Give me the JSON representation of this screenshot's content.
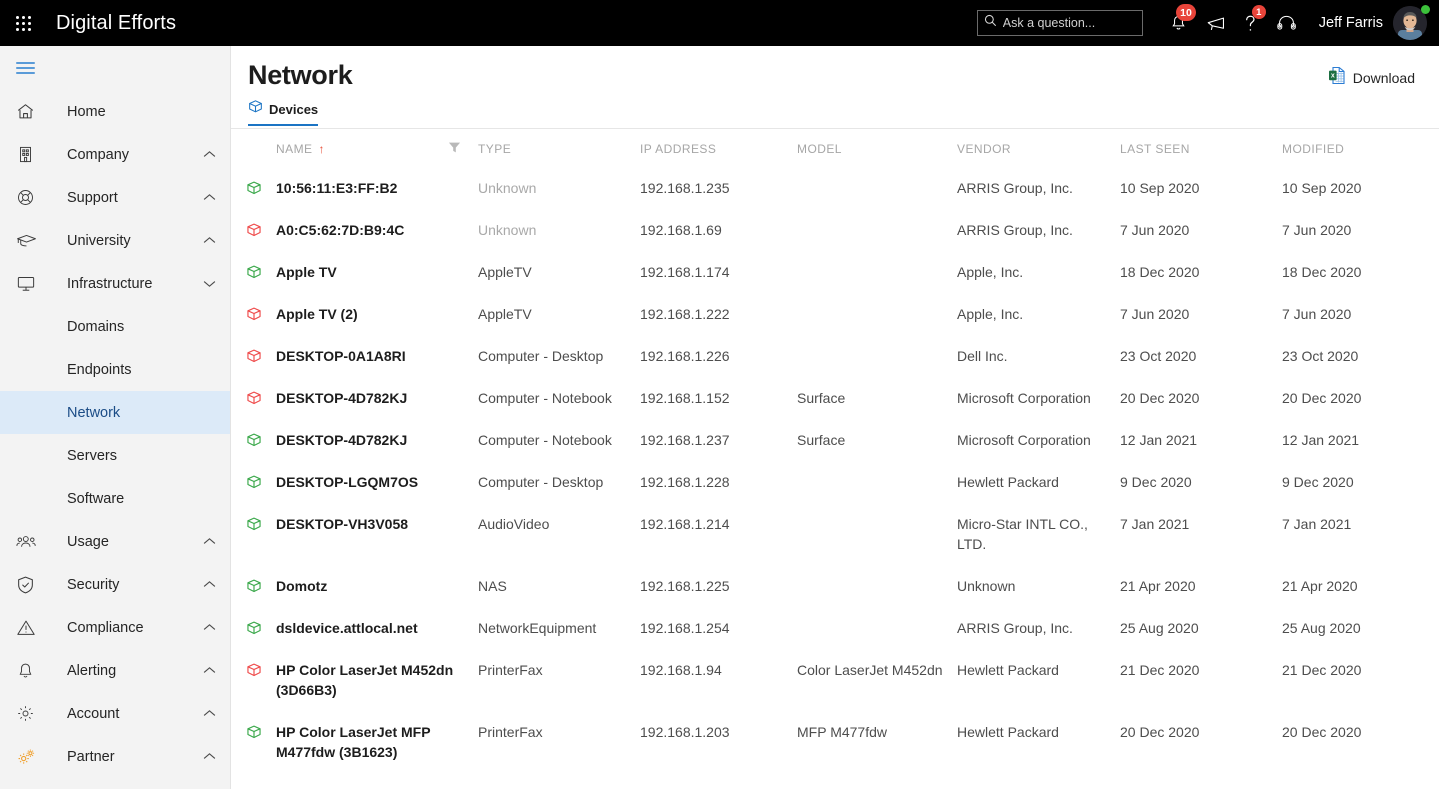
{
  "topbar": {
    "waffle_icon": "app-launcher-icon",
    "brand": "Digital Efforts",
    "search": {
      "placeholder": "Ask a question...",
      "value": "",
      "icon": "search-icon"
    },
    "notifications": {
      "icon": "bell-icon",
      "badge": "10"
    },
    "announcements": {
      "icon": "megaphone-icon"
    },
    "help": {
      "icon": "question-mark-icon",
      "badge": "1"
    },
    "support": {
      "icon": "headset-icon"
    },
    "user": {
      "name": "Jeff Farris",
      "status": "online",
      "status_color": "#3cc13b"
    }
  },
  "sidebar": {
    "menu_icon": "hamburger-icon",
    "accent": "#5a9bd8",
    "active_bg": "#dceaf8",
    "items": [
      {
        "label": "Home",
        "icon": "home-icon",
        "chevron": "",
        "child": false,
        "active": false
      },
      {
        "label": "Company",
        "icon": "building-icon",
        "chevron": "up",
        "child": false,
        "active": false
      },
      {
        "label": "Support",
        "icon": "lifebuoy-icon",
        "chevron": "up",
        "child": false,
        "active": false
      },
      {
        "label": "University",
        "icon": "graduation-cap-icon",
        "chevron": "up",
        "child": false,
        "active": false
      },
      {
        "label": "Infrastructure",
        "icon": "monitor-icon",
        "chevron": "down",
        "child": false,
        "active": false
      },
      {
        "label": "Domains",
        "icon": "",
        "chevron": "",
        "child": true,
        "active": false
      },
      {
        "label": "Endpoints",
        "icon": "",
        "chevron": "",
        "child": true,
        "active": false
      },
      {
        "label": "Network",
        "icon": "",
        "chevron": "",
        "child": true,
        "active": true
      },
      {
        "label": "Servers",
        "icon": "",
        "chevron": "",
        "child": true,
        "active": false
      },
      {
        "label": "Software",
        "icon": "",
        "chevron": "",
        "child": true,
        "active": false
      },
      {
        "label": "Usage",
        "icon": "people-icon",
        "chevron": "up",
        "child": false,
        "active": false
      },
      {
        "label": "Security",
        "icon": "shield-check-icon",
        "chevron": "up",
        "child": false,
        "active": false
      },
      {
        "label": "Compliance",
        "icon": "warning-triangle-icon",
        "chevron": "up",
        "child": false,
        "active": false
      },
      {
        "label": "Alerting",
        "icon": "bell-icon",
        "chevron": "up",
        "child": false,
        "active": false
      },
      {
        "label": "Account",
        "icon": "gear-icon",
        "chevron": "up",
        "child": false,
        "active": false
      },
      {
        "label": "Partner",
        "icon": "gears-icon",
        "chevron": "up",
        "child": false,
        "active": false,
        "icon_color": "#f0a02e"
      }
    ]
  },
  "page": {
    "title": "Network",
    "tabs": [
      {
        "label": "Devices",
        "icon": "cube-icon",
        "active": true
      }
    ],
    "download": {
      "label": "Download",
      "icon": "excel-file-icon"
    }
  },
  "table": {
    "columns": [
      "",
      "NAME",
      "",
      "TYPE",
      "IP ADDRESS",
      "MODEL",
      "VENDOR",
      "LAST SEEN",
      "MODIFIED"
    ],
    "sort": {
      "column": "NAME",
      "direction": "asc",
      "arrow": "↑",
      "color": "#e8503a"
    },
    "filter_icon": "filter-icon",
    "status_colors": {
      "online": "#3aa84a",
      "offline": "#ef4b4b"
    },
    "rows": [
      {
        "status": "online",
        "name": "10:56:11:E3:FF:B2",
        "type": "Unknown",
        "type_unknown": true,
        "ip": "192.168.1.235",
        "model": "",
        "vendor": "ARRIS Group, Inc.",
        "last_seen": "10 Sep 2020",
        "modified": "10 Sep 2020"
      },
      {
        "status": "offline",
        "name": "A0:C5:62:7D:B9:4C",
        "type": "Unknown",
        "type_unknown": true,
        "ip": "192.168.1.69",
        "model": "",
        "vendor": "ARRIS Group, Inc.",
        "last_seen": "7 Jun 2020",
        "modified": "7 Jun 2020"
      },
      {
        "status": "online",
        "name": "Apple TV",
        "type": "AppleTV",
        "type_unknown": false,
        "ip": "192.168.1.174",
        "model": "",
        "vendor": "Apple, Inc.",
        "last_seen": "18 Dec 2020",
        "modified": "18 Dec 2020"
      },
      {
        "status": "offline",
        "name": "Apple TV (2)",
        "type": "AppleTV",
        "type_unknown": false,
        "ip": "192.168.1.222",
        "model": "",
        "vendor": "Apple, Inc.",
        "last_seen": "7 Jun 2020",
        "modified": "7 Jun 2020"
      },
      {
        "status": "offline",
        "name": "DESKTOP-0A1A8RI",
        "type": "Computer - Desktop",
        "type_unknown": false,
        "ip": "192.168.1.226",
        "model": "",
        "vendor": "Dell Inc.",
        "last_seen": "23 Oct 2020",
        "modified": "23 Oct 2020"
      },
      {
        "status": "offline",
        "name": "DESKTOP-4D782KJ",
        "type": "Computer - Notebook",
        "type_unknown": false,
        "ip": "192.168.1.152",
        "model": "Surface",
        "vendor": "Microsoft Corporation",
        "last_seen": "20 Dec 2020",
        "modified": "20 Dec 2020"
      },
      {
        "status": "online",
        "name": "DESKTOP-4D782KJ",
        "type": "Computer - Notebook",
        "type_unknown": false,
        "ip": "192.168.1.237",
        "model": "Surface",
        "vendor": "Microsoft Corporation",
        "last_seen": "12 Jan 2021",
        "modified": "12 Jan 2021"
      },
      {
        "status": "online",
        "name": "DESKTOP-LGQM7OS",
        "type": "Computer - Desktop",
        "type_unknown": false,
        "ip": "192.168.1.228",
        "model": "",
        "vendor": "Hewlett Packard",
        "last_seen": "9 Dec 2020",
        "modified": "9 Dec 2020"
      },
      {
        "status": "online",
        "name": "DESKTOP-VH3V058",
        "type": "AudioVideo",
        "type_unknown": false,
        "ip": "192.168.1.214",
        "model": "",
        "vendor": "Micro-Star INTL CO., LTD.",
        "last_seen": "7 Jan 2021",
        "modified": "7 Jan 2021"
      },
      {
        "status": "online",
        "name": "Domotz",
        "type": "NAS",
        "type_unknown": false,
        "ip": "192.168.1.225",
        "model": "",
        "vendor": "Unknown",
        "last_seen": "21 Apr 2020",
        "modified": "21 Apr 2020"
      },
      {
        "status": "online",
        "name": "dsldevice.attlocal.net",
        "type": "NetworkEquipment",
        "type_unknown": false,
        "ip": "192.168.1.254",
        "model": "",
        "vendor": "ARRIS Group, Inc.",
        "last_seen": "25 Aug 2020",
        "modified": "25 Aug 2020"
      },
      {
        "status": "offline",
        "name": "HP Color LaserJet M452dn (3D66B3)",
        "type": "PrinterFax",
        "type_unknown": false,
        "ip": "192.168.1.94",
        "model": "Color LaserJet M452dn",
        "vendor": "Hewlett Packard",
        "last_seen": "21 Dec 2020",
        "modified": "21 Dec 2020"
      },
      {
        "status": "online",
        "name": "HP Color LaserJet MFP M477fdw (3B1623)",
        "type": "PrinterFax",
        "type_unknown": false,
        "ip": "192.168.1.203",
        "model": "MFP M477fdw",
        "vendor": "Hewlett Packard",
        "last_seen": "20 Dec 2020",
        "modified": "20 Dec 2020"
      }
    ]
  }
}
